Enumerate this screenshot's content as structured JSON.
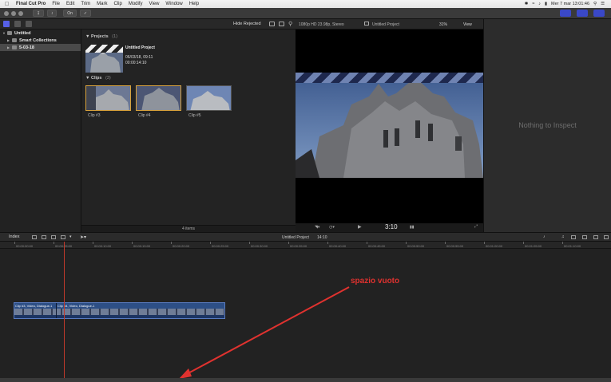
{
  "menubar": {
    "app_name": "Final Cut Pro",
    "items": [
      "File",
      "Edit",
      "Trim",
      "Mark",
      "Clip",
      "Modify",
      "View",
      "Window",
      "Help"
    ],
    "clock": "Mer 7 mar  13:01:46"
  },
  "toolbar": {
    "keyword_label": "On"
  },
  "browser_header": {
    "hide_rejected": "Hide Rejected"
  },
  "sidebar": {
    "items": [
      {
        "label": "Untitled"
      },
      {
        "label": "Smart Collections"
      },
      {
        "label": "5-03-18"
      }
    ]
  },
  "browser": {
    "projects_title": "Projects",
    "projects_count": "(1)",
    "project": {
      "name": "Untitled Project",
      "date": "06/03/18, 09:11",
      "duration": "00:00:14:10"
    },
    "clips_title": "Clips",
    "clips_count": "(3)",
    "clips": [
      {
        "label": "Clip #3"
      },
      {
        "label": "Clip #4"
      },
      {
        "label": "Clip #5"
      }
    ],
    "footer": "4 items"
  },
  "viewer_header": {
    "format": "1080p HD 23.98p, Stereo",
    "project_title": "Untitled Project",
    "zoom": "31%",
    "view_label": "View"
  },
  "viewer": {
    "timecode": "3:10"
  },
  "inspector": {
    "empty_text": "Nothing to Inspect"
  },
  "timeline_toolbar": {
    "index_label": "Index",
    "project_title": "Untitled Project",
    "duration": "14:10"
  },
  "ruler": {
    "ticks": [
      "00:00:00:00",
      "00:00:05:00",
      "00:00:10:00",
      "00:00:15:00",
      "00:00:20:00",
      "00:00:25:00",
      "00:00:30:00",
      "00:00:35:00",
      "00:00:40:00",
      "00:00:45:00",
      "00:00:50:00",
      "00:00:55:00",
      "00:01:00:00",
      "00:01:05:00",
      "00:01:10:00"
    ]
  },
  "timeline": {
    "clips": [
      {
        "label": "Clip #3, Video, Dialogue-1"
      },
      {
        "label": "Clip #4, Video, Dialogue-1"
      }
    ]
  },
  "annotation": {
    "text": "spazio vuoto",
    "color": "#e0322f"
  },
  "colors": {
    "accent": "#5660e6",
    "selection": "#d8a23c",
    "storyline": "#2d4f86",
    "playhead": "#c0392b"
  }
}
